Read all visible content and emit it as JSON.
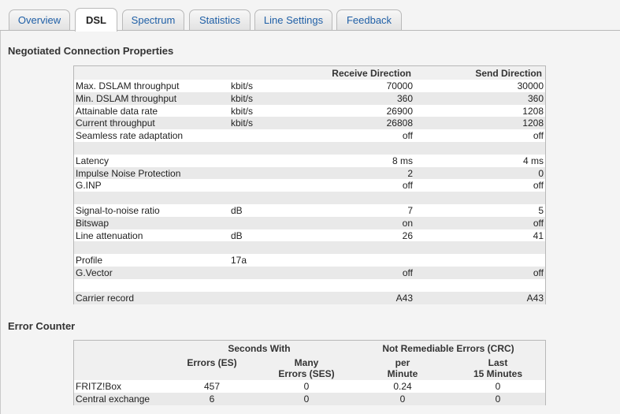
{
  "tabs": [
    {
      "label": "Overview"
    },
    {
      "label": "DSL"
    },
    {
      "label": "Spectrum"
    },
    {
      "label": "Statistics"
    },
    {
      "label": "Line Settings"
    },
    {
      "label": "Feedback"
    }
  ],
  "negotiated": {
    "title": "Negotiated Connection Properties",
    "header": {
      "receive": "Receive Direction",
      "send": "Send Direction"
    },
    "rows": [
      {
        "label": "Max. DSLAM throughput",
        "unit": "kbit/s",
        "receive": "70000",
        "send": "30000"
      },
      {
        "label": "Min. DSLAM throughput",
        "unit": "kbit/s",
        "receive": "360",
        "send": "360"
      },
      {
        "label": "Attainable data rate",
        "unit": "kbit/s",
        "receive": "26900",
        "send": "1208"
      },
      {
        "label": "Current throughput",
        "unit": "kbit/s",
        "receive": "26808",
        "send": "1208"
      },
      {
        "label": "Seamless rate adaptation",
        "unit": "",
        "receive": "off",
        "send": "off"
      },
      {
        "label": "",
        "unit": "",
        "receive": "",
        "send": ""
      },
      {
        "label": "Latency",
        "unit": "",
        "receive": "8 ms",
        "send": "4 ms"
      },
      {
        "label": "Impulse Noise Protection",
        "unit": "",
        "receive": "2",
        "send": "0"
      },
      {
        "label": "G.INP",
        "unit": "",
        "receive": "off",
        "send": "off"
      },
      {
        "label": "",
        "unit": "",
        "receive": "",
        "send": ""
      },
      {
        "label": "Signal-to-noise ratio",
        "unit": "dB",
        "receive": "7",
        "send": "5"
      },
      {
        "label": "Bitswap",
        "unit": "",
        "receive": "on",
        "send": "off"
      },
      {
        "label": "Line attenuation",
        "unit": "dB",
        "receive": "26",
        "send": "41"
      },
      {
        "label": "",
        "unit": "",
        "receive": "",
        "send": ""
      },
      {
        "label": "Profile",
        "unit": "17a",
        "receive": "",
        "send": ""
      },
      {
        "label": "G.Vector",
        "unit": "",
        "receive": "off",
        "send": "off"
      },
      {
        "label": "",
        "unit": "",
        "receive": "",
        "send": ""
      },
      {
        "label": "Carrier record",
        "unit": "",
        "receive": "A43",
        "send": "A43"
      }
    ]
  },
  "errors": {
    "title": "Error Counter",
    "group1": "Seconds With",
    "group2": "Not Remediable Errors (CRC)",
    "col1": "Errors (ES)",
    "col2_line1": "Many",
    "col2_line2": "Errors (SES)",
    "col3_line1": "per",
    "col3_line2": "Minute",
    "col4_line1": "Last",
    "col4_line2": "15 Minutes",
    "rows": [
      {
        "label": "FRITZ!Box",
        "es": "457",
        "ses": "0",
        "per_min": "0.24",
        "last15": "0"
      },
      {
        "label": "Central exchange",
        "es": "6",
        "ses": "0",
        "per_min": "0",
        "last15": "0"
      }
    ]
  }
}
